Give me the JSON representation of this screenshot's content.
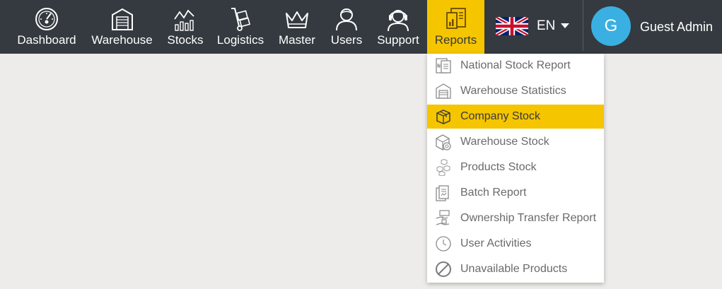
{
  "nav": {
    "items": [
      {
        "label": "Dashboard",
        "icon": "dashboard-gauge-icon"
      },
      {
        "label": "Warehouse",
        "icon": "warehouse-icon"
      },
      {
        "label": "Stocks",
        "icon": "stocks-chart-icon"
      },
      {
        "label": "Logistics",
        "icon": "logistics-handtruck-icon"
      },
      {
        "label": "Master",
        "icon": "crown-icon"
      },
      {
        "label": "Users",
        "icon": "user-icon"
      },
      {
        "label": "Support",
        "icon": "headset-icon"
      },
      {
        "label": "Reports",
        "icon": "reports-icon",
        "active": true
      }
    ]
  },
  "language": {
    "code": "EN",
    "flag": "uk-flag-icon"
  },
  "user": {
    "initial": "G",
    "name": "Guest Admin"
  },
  "reports_menu": {
    "items": [
      {
        "label": "National Stock Report",
        "icon": "national-report-icon"
      },
      {
        "label": "Warehouse Statistics",
        "icon": "warehouse-statistics-icon"
      },
      {
        "label": "Company Stock",
        "icon": "box-icon",
        "active": true
      },
      {
        "label": "Warehouse Stock",
        "icon": "warehouse-stock-icon"
      },
      {
        "label": "Products Stock",
        "icon": "boxes-icon"
      },
      {
        "label": "Batch Report",
        "icon": "documents-icon"
      },
      {
        "label": "Ownership Transfer Report",
        "icon": "transfer-hand-icon"
      },
      {
        "label": "User Activities",
        "icon": "clock-icon"
      },
      {
        "label": "Unavailable Products",
        "icon": "prohibited-icon"
      }
    ]
  },
  "colors": {
    "topbar": "#343a40",
    "accent": "#f5c500",
    "avatar": "#3ab0e2",
    "background": "#edecea"
  }
}
